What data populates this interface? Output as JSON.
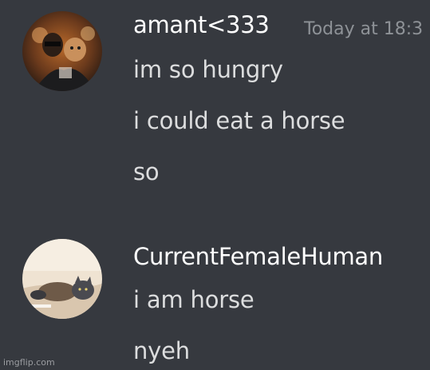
{
  "messages": [
    {
      "username": "amant<333",
      "timestamp": "Today at 18:3",
      "lines": [
        "im so hungry",
        "i could eat a horse",
        "so"
      ],
      "avatar_icon": "user-avatar-photo"
    },
    {
      "username": "CurrentFemaleHuman",
      "lines": [
        "i am horse",
        "nyeh"
      ],
      "avatar_icon": "cat-avatar-photo"
    }
  ],
  "watermark": "imgflip.com",
  "colors": {
    "background": "#36393f",
    "username": "#ffffff",
    "message": "#dcddde",
    "timestamp": "#8e9297"
  }
}
